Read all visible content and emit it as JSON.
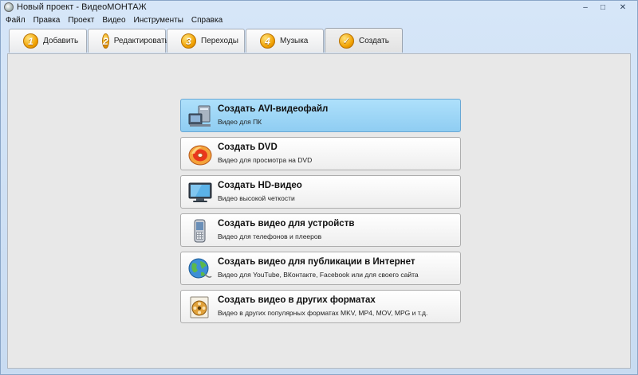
{
  "window": {
    "title": "Новый проект - ВидеоМОНТАЖ",
    "controls": {
      "minimize": "‒",
      "maximize": "□",
      "close": "✕"
    }
  },
  "menu": [
    {
      "label": "Файл"
    },
    {
      "label": "Правка"
    },
    {
      "label": "Проект"
    },
    {
      "label": "Видео"
    },
    {
      "label": "Инструменты"
    },
    {
      "label": "Справка"
    }
  ],
  "tabs": [
    {
      "num": "1",
      "label": "Добавить",
      "icon": "number-badge-icon"
    },
    {
      "num": "2",
      "label": "Редактировать",
      "icon": "number-badge-icon"
    },
    {
      "num": "3",
      "label": "Переходы",
      "icon": "number-badge-icon"
    },
    {
      "num": "4",
      "label": "Музыка",
      "icon": "number-badge-icon"
    },
    {
      "num": "✓",
      "label": "Создать",
      "icon": "checkmark-badge-icon",
      "active": true
    }
  ],
  "options": [
    {
      "title": "Создать AVI-видеофайл",
      "subtitle": "Видео для ПК",
      "icon": "pc-video-icon",
      "selected": true
    },
    {
      "title": "Создать DVD",
      "subtitle": "Видео для просмотра на DVD",
      "icon": "dvd-disc-icon"
    },
    {
      "title": "Создать HD-видео",
      "subtitle": "Видео высокой четкости",
      "icon": "monitor-icon"
    },
    {
      "title": "Создать видео для устройств",
      "subtitle": "Видео для телефонов и плееров",
      "icon": "mobile-phone-icon"
    },
    {
      "title": "Создать видео для публикации в Интернет",
      "subtitle": "Видео для YouTube, ВКонтакте, Facebook или для своего сайта",
      "icon": "globe-icon"
    },
    {
      "title": "Создать видео в других форматах",
      "subtitle": "Видео в других популярных форматах MKV, MP4, MOV, MPG и т.д.",
      "icon": "film-reel-icon"
    }
  ],
  "colors": {
    "selected_option": "#9dd6f7",
    "tab_badge": "#f0a000",
    "window_frame": "#d6e6f8"
  }
}
